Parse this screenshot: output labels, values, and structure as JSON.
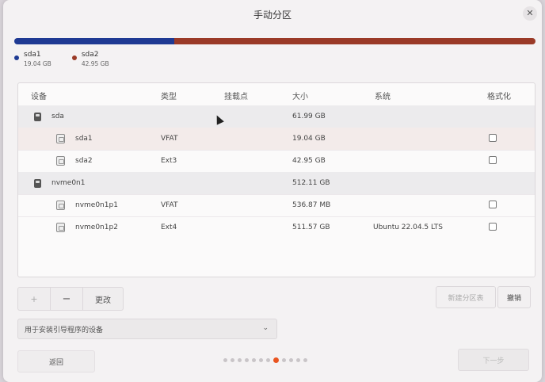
{
  "window": {
    "title": "手动分区",
    "close_glyph": "✕"
  },
  "usage": {
    "segments": [
      {
        "name": "sda1",
        "size": "19.04 GB",
        "color": "#1f3a93",
        "fraction": 0.307
      },
      {
        "name": "sda2",
        "size": "42.95 GB",
        "color": "#9a3a27",
        "fraction": 0.693
      }
    ]
  },
  "table": {
    "headers": {
      "device": "设备",
      "type": "类型",
      "mount": "挂载点",
      "size": "大小",
      "system": "系统",
      "format": "格式化"
    },
    "rows": [
      {
        "kind": "device",
        "name": "sda",
        "type": "",
        "size": "61.99 GB",
        "system": ""
      },
      {
        "kind": "partition",
        "name": "sda1",
        "type": "VFAT",
        "size": "19.04 GB",
        "system": ""
      },
      {
        "kind": "partition",
        "name": "sda2",
        "type": "Ext3",
        "size": "42.95 GB",
        "system": ""
      },
      {
        "kind": "device",
        "name": "nvme0n1",
        "type": "",
        "size": "512.11 GB",
        "system": ""
      },
      {
        "kind": "partition",
        "name": "nvme0n1p1",
        "type": "VFAT",
        "size": "536.87 MB",
        "system": ""
      },
      {
        "kind": "partition",
        "name": "nvme0n1p2",
        "type": "Ext4",
        "size": "511.57 GB",
        "system": "Ubuntu 22.04.5 LTS"
      }
    ]
  },
  "toolbar": {
    "add": "+",
    "remove": "−",
    "change": "更改",
    "new_table": "新建分区表",
    "revert": "撤销"
  },
  "boot_loader": {
    "label": "用于安装引导程序的设备",
    "chevron": "⌄"
  },
  "nav": {
    "back": "返回",
    "next": "下一步",
    "step_total": 12,
    "step_active": 8
  }
}
